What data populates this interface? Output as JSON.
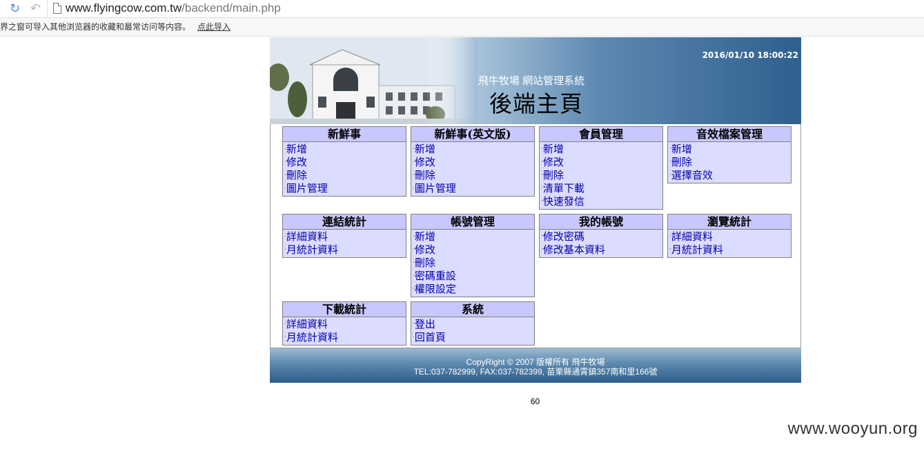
{
  "browser": {
    "url_host": "www.flyingcow.com.tw",
    "url_path": "/backend/main.php",
    "infobar_text": "界之窗可导入其他浏览器的收藏和最常访问等内容。",
    "infobar_link": "点此导入"
  },
  "banner": {
    "subtitle": "飛牛牧場 網站管理系統",
    "title": "後端主頁",
    "datetime": "2016/01/10 18:00:22"
  },
  "menu": [
    {
      "title": "新鮮事",
      "items": [
        "新增",
        "修改",
        "刪除",
        "圖片管理"
      ]
    },
    {
      "title": "新鮮事(英文版)",
      "items": [
        "新增",
        "修改",
        "刪除",
        "圖片管理"
      ]
    },
    {
      "title": "會員管理",
      "items": [
        "新增",
        "修改",
        "刪除",
        "清單下載",
        "快速發信"
      ]
    },
    {
      "title": "音效檔案管理",
      "items": [
        "新增",
        "刪除",
        "選擇音效"
      ]
    },
    {
      "title": "連結統計",
      "items": [
        "詳細資料",
        "月統計資料"
      ]
    },
    {
      "title": "帳號管理",
      "items": [
        "新增",
        "修改",
        "刪除",
        "密碼重設",
        "權限設定"
      ]
    },
    {
      "title": "我的帳號",
      "items": [
        "修改密碼",
        "修改基本資料"
      ]
    },
    {
      "title": "瀏覽統計",
      "items": [
        "詳細資料",
        "月統計資料"
      ]
    },
    {
      "title": "下載統計",
      "items": [
        "詳細資料",
        "月統計資料"
      ]
    },
    {
      "title": "系統",
      "items": [
        "登出",
        "回首頁"
      ]
    }
  ],
  "footer": {
    "line1": "CopyRight © 2007 版權所有 飛牛牧場",
    "line2": "TEL:037-782999, FAX:037-782399, 苗栗縣通霄鎮357南和里166號"
  },
  "page_number": "60",
  "watermark": "www.wooyun.org"
}
